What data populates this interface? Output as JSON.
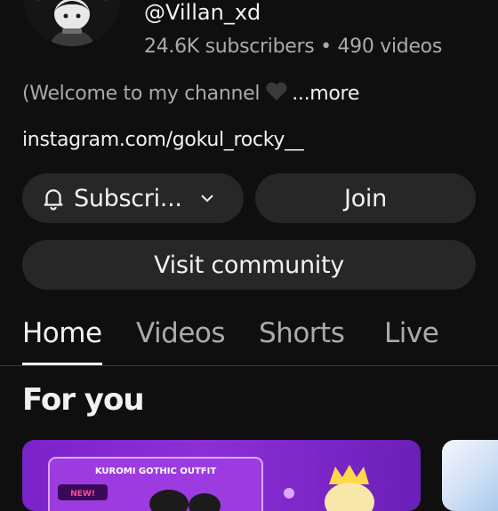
{
  "channel": {
    "handle": "@Villan_xd",
    "stats": "24.6K subscribers • 490 videos",
    "description": "(Welcome to my channel",
    "more_label": "...more",
    "link": "instagram.com/gokul_rocky__"
  },
  "actions": {
    "subscribe_label": "Subscri...",
    "join_label": "Join",
    "visit_label": "Visit community"
  },
  "tabs": [
    {
      "label": "Home",
      "active": true
    },
    {
      "label": "Videos"
    },
    {
      "label": "Shorts"
    },
    {
      "label": "Live"
    }
  ],
  "section": {
    "title": "For you"
  },
  "thumbnail": {
    "title_text": "KUROMI GOTHIC OUTFIT",
    "badge": "NEW!"
  },
  "colors": {
    "background": "#0f0f0f",
    "button": "#272727",
    "text": "#f1f1f1",
    "muted": "#aaaaaa",
    "accent": "#7b22c9"
  }
}
